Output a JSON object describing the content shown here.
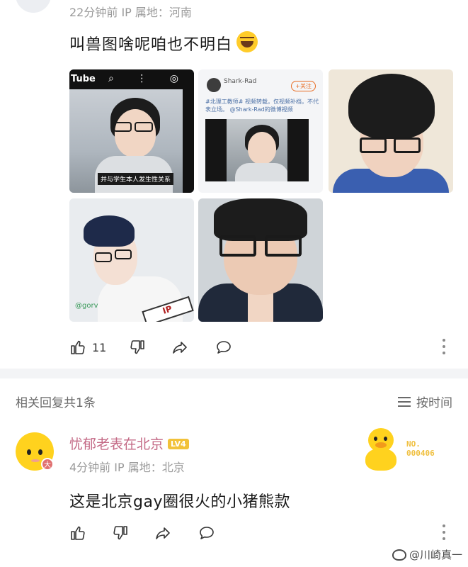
{
  "post": {
    "meta": "22分钟前 IP 属地：河南",
    "text": "叫兽图啥呢咱也不明白",
    "emoji_icon": "laughing-tears-emoji",
    "images": {
      "img1": {
        "platform_label": "Tube",
        "caption": "并与学生本人发生性关系"
      },
      "img2": {
        "user": "Shark-Rad",
        "follow": "+关注",
        "body": "#北理工教师# 视频转载，仅视频补档，不代表立场。 @Shark-Rad的微博视频"
      },
      "img4": {
        "watermark": "@gorv",
        "shirt_text": "IP"
      }
    },
    "actions": {
      "like_count": "11"
    }
  },
  "replies": {
    "header": "相关回复共1条",
    "sort_label": "按时间",
    "items": [
      {
        "name": "忧郁老表在北京",
        "level": "LV4",
        "badge": "大",
        "meta": "4分钟前 IP 属地：北京",
        "text": "这是北京gay圈很火的小猪熊款",
        "medal_line1": "NO.",
        "medal_line2": "000406"
      }
    ]
  },
  "watermark": {
    "text": "@川崎真一"
  },
  "colors": {
    "username": "#c46a86",
    "meta": "#9a9a9a",
    "level_badge": "#f2c23a"
  }
}
